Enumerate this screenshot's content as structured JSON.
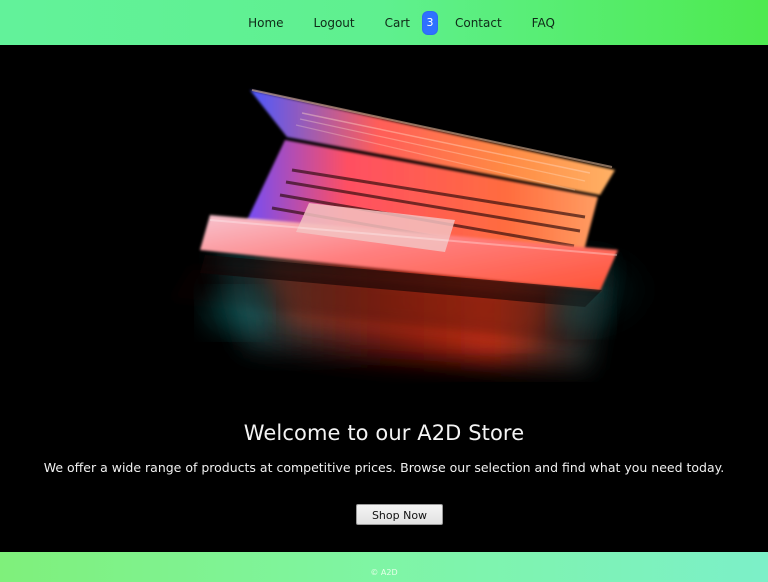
{
  "nav": {
    "items": [
      {
        "label": "Home"
      },
      {
        "label": "Logout"
      },
      {
        "label": "Cart"
      },
      {
        "label": "Contact"
      },
      {
        "label": "FAQ"
      }
    ],
    "cart_count": "3"
  },
  "hero": {
    "title": "Welcome to our A2D Store",
    "subtitle": "We offer a wide range of products at competitive prices. Browse our selection and find what you need today.",
    "button_label": "Shop Now"
  },
  "footer": {
    "text": "© A2D"
  },
  "colors": {
    "header_gradient_start": "#62f29a",
    "header_gradient_end": "#4eea4f",
    "hero_background": "#000000",
    "cart_badge": "#2f71ff",
    "footer_gradient_start": "#7ff07b",
    "footer_gradient_end": "#7cf0c8"
  }
}
